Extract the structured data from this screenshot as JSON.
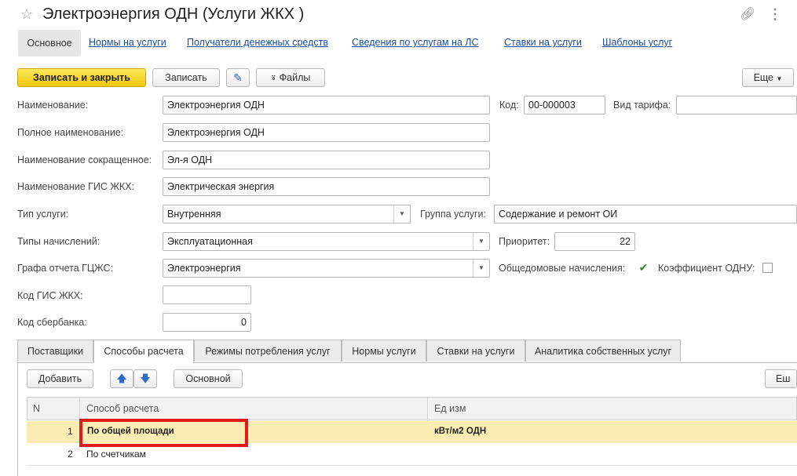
{
  "window": {
    "title": "Электроэнергия ОДН (Услуги ЖКХ )"
  },
  "nav": {
    "active": "Основное",
    "links": [
      "Нормы на услуги",
      "Получатели денежных средств",
      "Сведения по услугам на ЛС",
      "Ставки на услуги",
      "Шаблоны услуг"
    ]
  },
  "toolbar": {
    "save_close": "Записать и закрыть",
    "save": "Записать",
    "files": "Файлы",
    "more": "Еще"
  },
  "form": {
    "name_label": "Наименование:",
    "name_value": "Электроэнергия ОДН",
    "code_label": "Код:",
    "code_value": "00-000003",
    "tariff_label": "Вид тарифа:",
    "tariff_value": "",
    "full_name_label": "Полное наименование:",
    "full_name_value": "Электроэнергия ОДН",
    "short_name_label": "Наименование сокращенное:",
    "short_name_value": "Эл-я ОДН",
    "gis_name_label": "Наименование ГИС ЖКХ:",
    "gis_name_value": "Электрическая энергия",
    "service_type_label": "Тип услуги:",
    "service_type_value": "Внутренняя",
    "service_group_label": "Группа услуги:",
    "service_group_value": "Содержание и ремонт ОИ",
    "charge_types_label": "Типы начислений:",
    "charge_types_value": "Эксплуатационная",
    "priority_label": "Приоритет:",
    "priority_value": "22",
    "report_col_label": "Графа отчета ГЦЖС:",
    "report_col_value": "Электроэнергия",
    "common_charges_label": "Общедомовые начисления:",
    "common_charges_checked": true,
    "odn_coef_label": "Коэффициент ОДНУ:",
    "odn_coef_checked": false,
    "gis_code_label": "Код ГИС ЖКХ:",
    "gis_code_value": "",
    "sber_code_label": "Код сбербанка:",
    "sber_code_value": "0"
  },
  "tabs": [
    "Поставщики",
    "Способы расчета",
    "Режимы потребления услуг",
    "Нормы услуги",
    "Ставки на услуги",
    "Аналитика собственных услуг"
  ],
  "active_tab": "Способы расчета",
  "tab_toolbar": {
    "add": "Добавить",
    "main": "Основной",
    "more": "Еш"
  },
  "table": {
    "columns": [
      "N",
      "Способ расчета",
      "Ед изм"
    ],
    "rows": [
      {
        "n": "1",
        "method": "По общей площади",
        "unit": "кВт/м2 ОДН"
      },
      {
        "n": "2",
        "method": "По счетчикам",
        "unit": ""
      }
    ]
  },
  "colors": {
    "primary_button": "#f5d327",
    "selected_row": "#fbecb4",
    "highlight_box": "#e21a1a",
    "link": "#1a4d9c"
  }
}
